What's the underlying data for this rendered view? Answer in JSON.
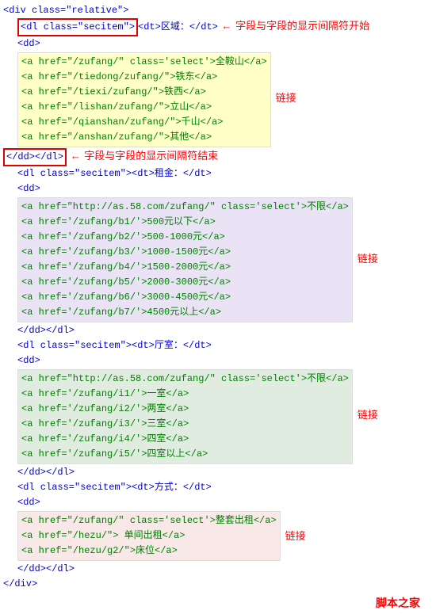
{
  "header_open": "<div class=\"relative\">",
  "ann_begin_arrow": "←",
  "ann_begin": "字段与字段的显示间隔符开始",
  "ann_end_arrow": "←",
  "ann_end": "字段与字段的显示间隔符结束",
  "ann_link": "链接",
  "footer": "脚本之家",
  "section1": {
    "dl_open": "<dl class=\"secitem\">",
    "dt": "<dt>区域：</dt>",
    "dd_open": "<dd>",
    "links": [
      "<a href=\"/zufang/\" class='select'>全鞍山</a>",
      "<a href=\"/tiedong/zufang/\">铁东</a>",
      "<a href=\"/tiexi/zufang/\">铁西</a>",
      "<a href=\"/lishan/zufang/\">立山</a>",
      "<a href=\"/qianshan/zufang/\">千山</a>",
      "<a href=\"/anshan/zufang/\">其他</a>"
    ],
    "dd_close": "</dd>",
    "dl_close": "</dl>"
  },
  "section2": {
    "head": "<dl class=\"secitem\"><dt>租金：</dt>",
    "dd_open": "<dd>",
    "links": [
      "<a href=\"http://as.58.com/zufang/\" class='select'>不限</a>",
      "<a href='/zufang/b1/'>500元以下</a>",
      "<a href='/zufang/b2/'>500-1000元</a>",
      "<a href='/zufang/b3/'>1000-1500元</a>",
      "<a href='/zufang/b4/'>1500-2000元</a>",
      "<a href='/zufang/b5/'>2000-3000元</a>",
      "<a href='/zufang/b6/'>3000-4500元</a>",
      "<a href='/zufang/b7/'>4500元以上</a>"
    ],
    "close": "</dd></dl>"
  },
  "section3": {
    "head": "<dl class=\"secitem\"><dt>厅室：</dt>",
    "dd_open": "<dd>",
    "links": [
      "<a href=\"http://as.58.com/zufang/\" class='select'>不限</a>",
      "<a href='/zufang/i1/'>一室</a>",
      "<a href='/zufang/i2/'>两室</a>",
      "<a href='/zufang/i3/'>三室</a>",
      "<a href='/zufang/i4/'>四室</a>",
      "<a href='/zufang/i5/'>四室以上</a>"
    ],
    "close": "</dd></dl>"
  },
  "section4": {
    "head": "<dl class=\"secitem\"><dt>方式：</dt>",
    "dd_open": "<dd>",
    "links": [
      "<a href=\"/zufang/\" class='select'>整套出租</a>",
      "<a href=\"/hezu/\"> 单间出租</a>",
      "<a href=\"/hezu/g2/\">床位</a>"
    ],
    "close": "</dd></dl>"
  },
  "footer_close": "</div>"
}
